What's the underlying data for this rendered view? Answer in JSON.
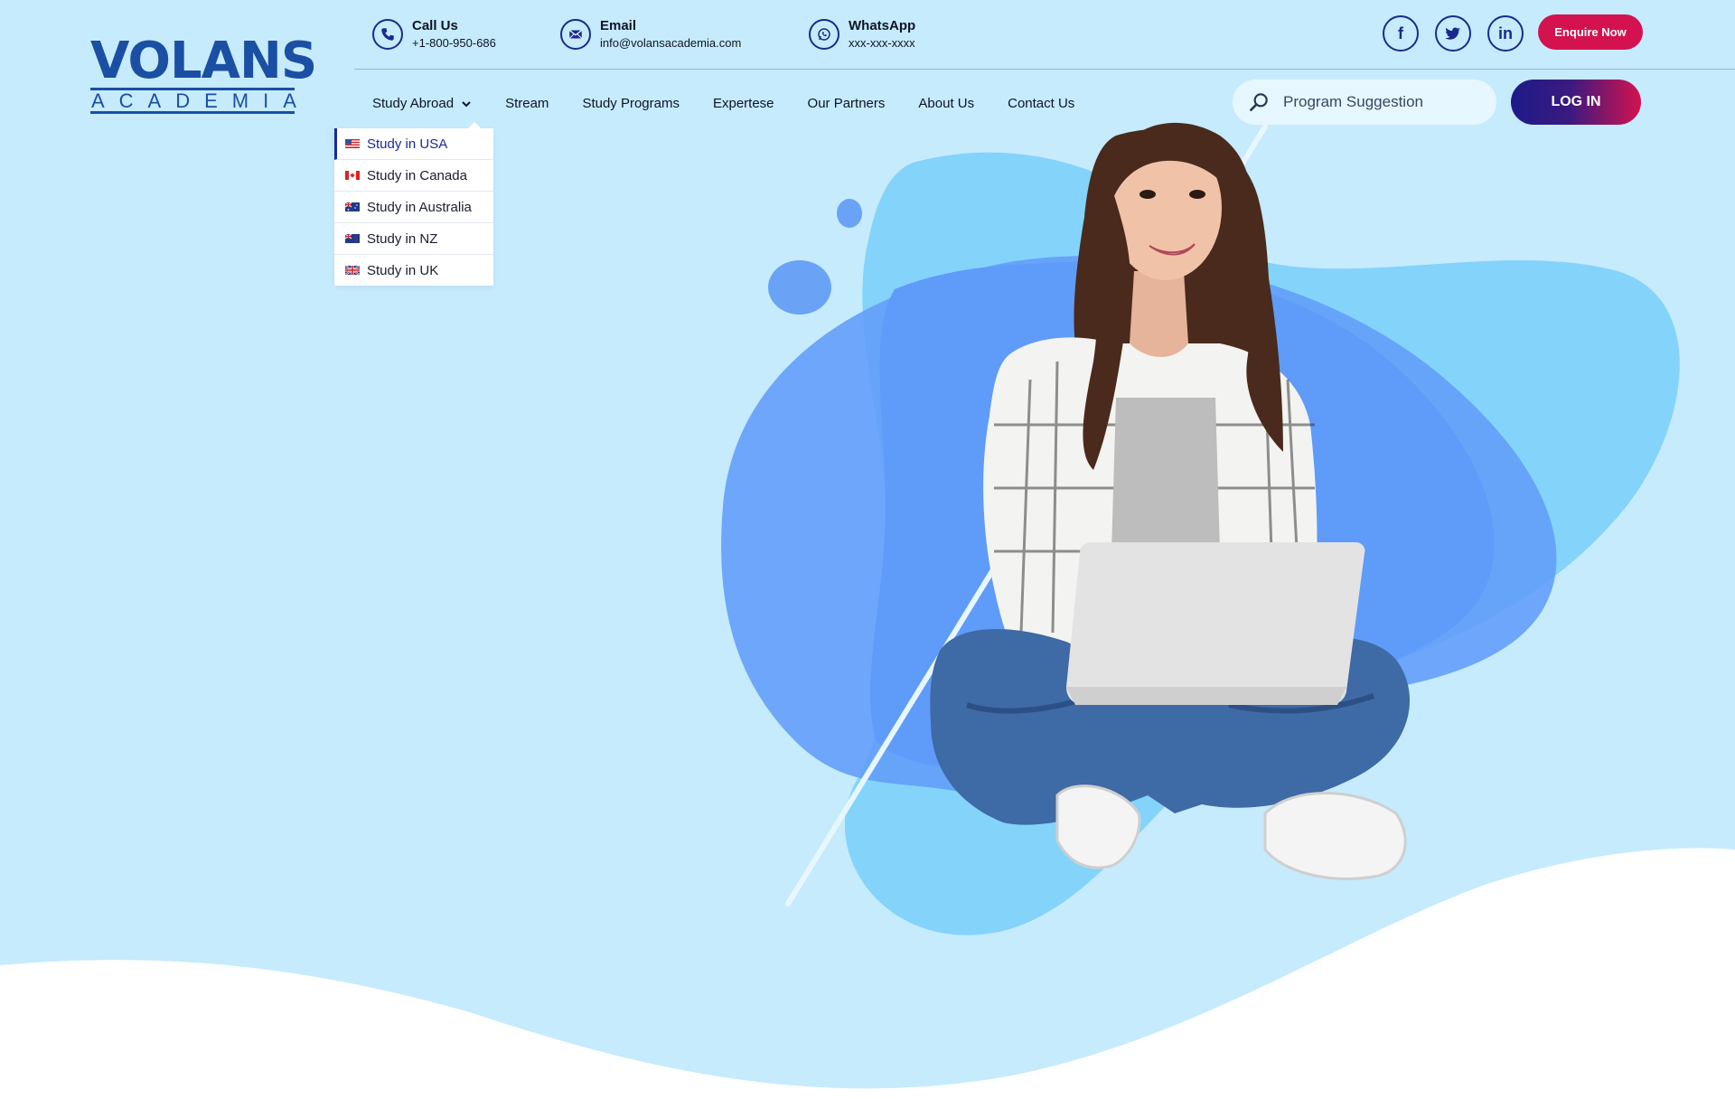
{
  "brand": {
    "main": "VOLANS",
    "sub": "ACADEMIA"
  },
  "contacts": [
    {
      "title": "Call Us",
      "value": "+1-800-950-686",
      "icon": "phone-icon"
    },
    {
      "title": "Email",
      "value": "info@volansacademia.com",
      "icon": "mail-icon"
    },
    {
      "title": "WhatsApp",
      "value": "xxx-xxx-xxxx",
      "icon": "whatsapp-icon"
    }
  ],
  "social": {
    "facebook": "f",
    "linkedin": "in"
  },
  "enquire_label": "Enquire Now",
  "nav": [
    "Study Abroad",
    "Stream",
    "Study Programs",
    "Expertese",
    "Our Partners",
    "About Us",
    "Contact Us"
  ],
  "search": {
    "placeholder": "Program Suggestion"
  },
  "login_label": "LOG IN",
  "dropdown": [
    "Study in USA",
    "Study in Canada",
    "Study in Australia",
    "Study in NZ",
    "Study in UK"
  ],
  "colors": {
    "background": "#c5ebfd",
    "accent": "#d4124f",
    "navy": "#1a2a8c",
    "brand": "#1b4fa4"
  }
}
